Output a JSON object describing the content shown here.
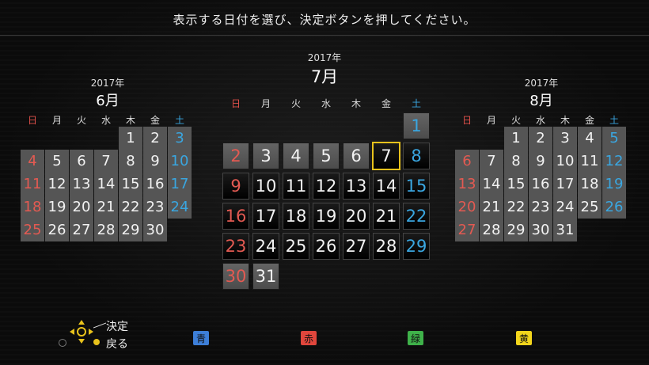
{
  "instruction": "表示する日付を選び、決定ボタンを押してください。",
  "weekdays": [
    "日",
    "月",
    "火",
    "水",
    "木",
    "金",
    "土"
  ],
  "months": {
    "prev": {
      "year": "2017年",
      "month": "6月",
      "cells": [
        "",
        "",
        "",
        "",
        "1",
        "2",
        "3",
        "4",
        "5",
        "6",
        "7",
        "8",
        "9",
        "10",
        "11",
        "12",
        "13",
        "14",
        "15",
        "16",
        "17",
        "18",
        "19",
        "20",
        "21",
        "22",
        "23",
        "24",
        "25",
        "26",
        "27",
        "28",
        "29",
        "30",
        ""
      ]
    },
    "current": {
      "year": "2017年",
      "month": "7月",
      "selected": "7",
      "cells": [
        "",
        "",
        "",
        "",
        "",
        "",
        "1",
        "2",
        "3",
        "4",
        "5",
        "6",
        "7",
        "8",
        "9",
        "10",
        "11",
        "12",
        "13",
        "14",
        "15",
        "16",
        "17",
        "18",
        "19",
        "20",
        "21",
        "22",
        "23",
        "24",
        "25",
        "26",
        "27",
        "28",
        "29",
        "30",
        "31",
        "",
        "",
        "",
        "",
        ""
      ]
    },
    "next": {
      "year": "2017年",
      "month": "8月",
      "cells": [
        "",
        "",
        "1",
        "2",
        "3",
        "4",
        "5",
        "6",
        "7",
        "8",
        "9",
        "10",
        "11",
        "12",
        "13",
        "14",
        "15",
        "16",
        "17",
        "18",
        "19",
        "20",
        "21",
        "22",
        "23",
        "24",
        "25",
        "26",
        "27",
        "28",
        "29",
        "30",
        "31",
        "",
        ""
      ]
    }
  },
  "controls": {
    "decide": "決定",
    "back": "戻る"
  },
  "color_buttons": [
    {
      "label": "青",
      "color": "#3d7fd8"
    },
    {
      "label": "赤",
      "color": "#e0463c"
    },
    {
      "label": "緑",
      "color": "#3fb24a"
    },
    {
      "label": "黄",
      "color": "#f2d51c"
    }
  ]
}
